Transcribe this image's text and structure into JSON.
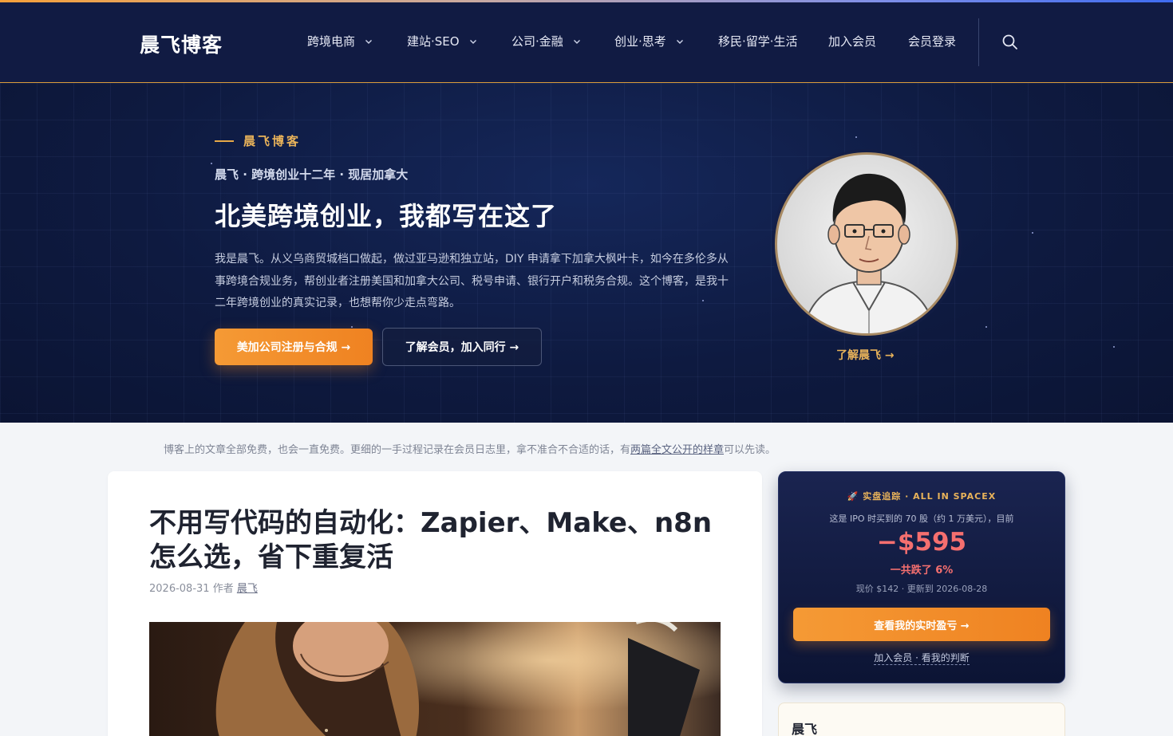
{
  "header": {
    "brand": "晨飞博客",
    "nav": [
      {
        "label": "跨境电商",
        "has_dropdown": true
      },
      {
        "label": "建站·SEO",
        "has_dropdown": true
      },
      {
        "label": "公司·金融",
        "has_dropdown": true
      },
      {
        "label": "创业·思考",
        "has_dropdown": true
      },
      {
        "label": "移民·留学·生活",
        "has_dropdown": false
      },
      {
        "label": "加入会员",
        "has_dropdown": false
      },
      {
        "label": "会员登录",
        "has_dropdown": false
      }
    ],
    "search_icon": "search-icon"
  },
  "hero": {
    "eyebrow": "晨飞博客",
    "subtitle": "晨飞 · 跨境创业十二年 · 现居加拿大",
    "title": "北美跨境创业，我都写在这了",
    "description": "我是晨飞。从义乌商贸城档口做起，做过亚马逊和独立站，DIY 申请拿下加拿大枫叶卡，如今在多伦多从事跨境合规业务，帮创业者注册美国和加拿大公司、税号申请、银行开户和税务合规。这个博客，是我十二年跨境创业的真实记录，也想帮你少走点弯路。",
    "primary_button": "美加公司注册与合规 →",
    "secondary_button": "了解会员，加入同行 →",
    "about_link": "了解晨飞 →"
  },
  "notice": {
    "text_before": "博客上的文章全部免费，也会一直免费。更细的一手过程记录在会员日志里，拿不准合不合适的话，有",
    "link": "两篇全文公开的样章",
    "text_after": "可以先读。"
  },
  "article": {
    "title": "不用写代码的自动化：Zapier、Make、n8n 怎么选，省下重复活",
    "date": "2026-08-31",
    "author_prefix": "作者",
    "author": "晨飞"
  },
  "tracker": {
    "eyebrow": "🚀 实盘追踪 · ALL IN SPACEX",
    "line1": "这是 IPO 时买到的 70 股（约 1 万美元），目前",
    "amount": "−$595",
    "drop": "一共跌了 6%",
    "update": "现价 $142 · 更新到 2026-08-28",
    "cta": "查看我的实时盈亏 →",
    "sub_link": "加入会员 · 看我的判断"
  },
  "author_card": {
    "name": "晨飞"
  },
  "colors": {
    "header_bg": "#111b43",
    "accent_orange": "#f08a2a",
    "accent_gold": "#e9b35a",
    "loss_red": "#f56f6f"
  }
}
